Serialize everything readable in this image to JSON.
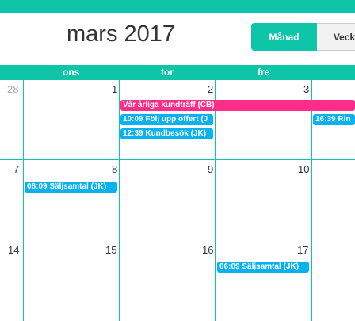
{
  "header": {
    "title": "mars 2017"
  },
  "views": {
    "month": "Månad",
    "week": "Veck"
  },
  "weekdays": [
    "ons",
    "tor",
    "fre"
  ],
  "weeks": [
    {
      "days": [
        "28",
        "1",
        "2",
        "3"
      ]
    },
    {
      "days": [
        "7",
        "8",
        "9",
        "10"
      ]
    },
    {
      "days": [
        "14",
        "15",
        "16",
        "17"
      ]
    }
  ],
  "events": [
    {
      "label": "Vår årliga kundträff (CB)",
      "color": "#ff2d8a"
    },
    {
      "label": "10:09 Följ upp offert (J",
      "color": "#09b1ef"
    },
    {
      "label": "12:39 Kundbesök (JK)",
      "color": "#09b1ef"
    },
    {
      "label": "16:39 Rin",
      "color": "#09b1ef"
    },
    {
      "label": "06:09 Säljsamtal (JK)",
      "color": "#09b1ef"
    },
    {
      "label": "06:09 Säljsamtal (JK)",
      "color": "#09b1ef"
    }
  ]
}
